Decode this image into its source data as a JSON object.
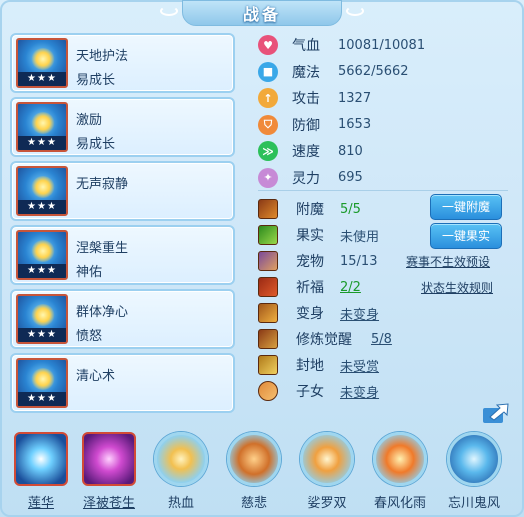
{
  "title": "战备",
  "skills": [
    {
      "name": "天地护法",
      "sub": "易成长",
      "stars": "★★★"
    },
    {
      "name": "激励",
      "sub": "易成长",
      "stars": "★★★"
    },
    {
      "name": "无声寂静",
      "sub": "",
      "stars": "★★★"
    },
    {
      "name": "涅槃重生",
      "sub": "神佑",
      "stars": "★★★"
    },
    {
      "name": "群体净心",
      "sub": "愤怒",
      "stars": "★★★"
    },
    {
      "name": "清心术",
      "sub": "",
      "stars": "★★★"
    }
  ],
  "stats": [
    {
      "label": "气血",
      "value": "10081/10081",
      "color": "#e8527a",
      "icon": "heart-icon"
    },
    {
      "label": "魔法",
      "value": "5662/5662",
      "color": "#3aa8e8",
      "icon": "mana-icon"
    },
    {
      "label": "攻击",
      "value": "1327",
      "color": "#f2a93a",
      "icon": "attack-icon"
    },
    {
      "label": "防御",
      "value": "1653",
      "color": "#f08a3a",
      "icon": "shield-icon"
    },
    {
      "label": "速度",
      "value": "810",
      "color": "#2cc05a",
      "icon": "speed-icon"
    },
    {
      "label": "灵力",
      "value": "695",
      "color": "#c78ad6",
      "icon": "spirit-icon"
    }
  ],
  "gear": [
    {
      "label": "附魔",
      "value": "5/5",
      "green": true
    },
    {
      "label": "果实",
      "value": "未使用"
    },
    {
      "label": "宠物",
      "value": "15/13"
    },
    {
      "label": "祈福",
      "value": "2/2",
      "green": true
    },
    {
      "label": "变身",
      "value": "未变身"
    },
    {
      "label": "修炼觉醒",
      "value": "5/8"
    },
    {
      "label": "封地",
      "value": "未受赏"
    },
    {
      "label": "子女",
      "value": "未变身"
    }
  ],
  "buttons": {
    "enchant": "一键附魔",
    "fruit": "一键果实"
  },
  "links": {
    "preset": "赛事不生效预设",
    "rules": "状态生效规则"
  },
  "bottom": [
    {
      "label": "莲华"
    },
    {
      "label": "泽被苍生"
    },
    {
      "label": "热血"
    },
    {
      "label": "慈悲"
    },
    {
      "label": "娑罗双"
    },
    {
      "label": "春风化雨"
    },
    {
      "label": "忘川鬼风"
    }
  ]
}
